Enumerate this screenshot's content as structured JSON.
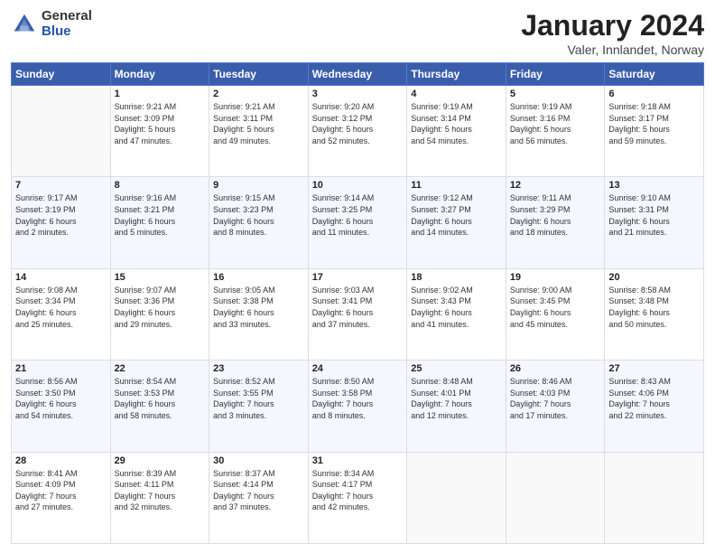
{
  "header": {
    "logo_general": "General",
    "logo_blue": "Blue",
    "title": "January 2024",
    "subtitle": "Valer, Innlandet, Norway"
  },
  "days_of_week": [
    "Sunday",
    "Monday",
    "Tuesday",
    "Wednesday",
    "Thursday",
    "Friday",
    "Saturday"
  ],
  "weeks": [
    [
      {
        "day": "",
        "info": ""
      },
      {
        "day": "1",
        "info": "Sunrise: 9:21 AM\nSunset: 3:09 PM\nDaylight: 5 hours\nand 47 minutes."
      },
      {
        "day": "2",
        "info": "Sunrise: 9:21 AM\nSunset: 3:11 PM\nDaylight: 5 hours\nand 49 minutes."
      },
      {
        "day": "3",
        "info": "Sunrise: 9:20 AM\nSunset: 3:12 PM\nDaylight: 5 hours\nand 52 minutes."
      },
      {
        "day": "4",
        "info": "Sunrise: 9:19 AM\nSunset: 3:14 PM\nDaylight: 5 hours\nand 54 minutes."
      },
      {
        "day": "5",
        "info": "Sunrise: 9:19 AM\nSunset: 3:16 PM\nDaylight: 5 hours\nand 56 minutes."
      },
      {
        "day": "6",
        "info": "Sunrise: 9:18 AM\nSunset: 3:17 PM\nDaylight: 5 hours\nand 59 minutes."
      }
    ],
    [
      {
        "day": "7",
        "info": "Sunrise: 9:17 AM\nSunset: 3:19 PM\nDaylight: 6 hours\nand 2 minutes."
      },
      {
        "day": "8",
        "info": "Sunrise: 9:16 AM\nSunset: 3:21 PM\nDaylight: 6 hours\nand 5 minutes."
      },
      {
        "day": "9",
        "info": "Sunrise: 9:15 AM\nSunset: 3:23 PM\nDaylight: 6 hours\nand 8 minutes."
      },
      {
        "day": "10",
        "info": "Sunrise: 9:14 AM\nSunset: 3:25 PM\nDaylight: 6 hours\nand 11 minutes."
      },
      {
        "day": "11",
        "info": "Sunrise: 9:12 AM\nSunset: 3:27 PM\nDaylight: 6 hours\nand 14 minutes."
      },
      {
        "day": "12",
        "info": "Sunrise: 9:11 AM\nSunset: 3:29 PM\nDaylight: 6 hours\nand 18 minutes."
      },
      {
        "day": "13",
        "info": "Sunrise: 9:10 AM\nSunset: 3:31 PM\nDaylight: 6 hours\nand 21 minutes."
      }
    ],
    [
      {
        "day": "14",
        "info": "Sunrise: 9:08 AM\nSunset: 3:34 PM\nDaylight: 6 hours\nand 25 minutes."
      },
      {
        "day": "15",
        "info": "Sunrise: 9:07 AM\nSunset: 3:36 PM\nDaylight: 6 hours\nand 29 minutes."
      },
      {
        "day": "16",
        "info": "Sunrise: 9:05 AM\nSunset: 3:38 PM\nDaylight: 6 hours\nand 33 minutes."
      },
      {
        "day": "17",
        "info": "Sunrise: 9:03 AM\nSunset: 3:41 PM\nDaylight: 6 hours\nand 37 minutes."
      },
      {
        "day": "18",
        "info": "Sunrise: 9:02 AM\nSunset: 3:43 PM\nDaylight: 6 hours\nand 41 minutes."
      },
      {
        "day": "19",
        "info": "Sunrise: 9:00 AM\nSunset: 3:45 PM\nDaylight: 6 hours\nand 45 minutes."
      },
      {
        "day": "20",
        "info": "Sunrise: 8:58 AM\nSunset: 3:48 PM\nDaylight: 6 hours\nand 50 minutes."
      }
    ],
    [
      {
        "day": "21",
        "info": "Sunrise: 8:56 AM\nSunset: 3:50 PM\nDaylight: 6 hours\nand 54 minutes."
      },
      {
        "day": "22",
        "info": "Sunrise: 8:54 AM\nSunset: 3:53 PM\nDaylight: 6 hours\nand 58 minutes."
      },
      {
        "day": "23",
        "info": "Sunrise: 8:52 AM\nSunset: 3:55 PM\nDaylight: 7 hours\nand 3 minutes."
      },
      {
        "day": "24",
        "info": "Sunrise: 8:50 AM\nSunset: 3:58 PM\nDaylight: 7 hours\nand 8 minutes."
      },
      {
        "day": "25",
        "info": "Sunrise: 8:48 AM\nSunset: 4:01 PM\nDaylight: 7 hours\nand 12 minutes."
      },
      {
        "day": "26",
        "info": "Sunrise: 8:46 AM\nSunset: 4:03 PM\nDaylight: 7 hours\nand 17 minutes."
      },
      {
        "day": "27",
        "info": "Sunrise: 8:43 AM\nSunset: 4:06 PM\nDaylight: 7 hours\nand 22 minutes."
      }
    ],
    [
      {
        "day": "28",
        "info": "Sunrise: 8:41 AM\nSunset: 4:09 PM\nDaylight: 7 hours\nand 27 minutes."
      },
      {
        "day": "29",
        "info": "Sunrise: 8:39 AM\nSunset: 4:11 PM\nDaylight: 7 hours\nand 32 minutes."
      },
      {
        "day": "30",
        "info": "Sunrise: 8:37 AM\nSunset: 4:14 PM\nDaylight: 7 hours\nand 37 minutes."
      },
      {
        "day": "31",
        "info": "Sunrise: 8:34 AM\nSunset: 4:17 PM\nDaylight: 7 hours\nand 42 minutes."
      },
      {
        "day": "",
        "info": ""
      },
      {
        "day": "",
        "info": ""
      },
      {
        "day": "",
        "info": ""
      }
    ]
  ]
}
